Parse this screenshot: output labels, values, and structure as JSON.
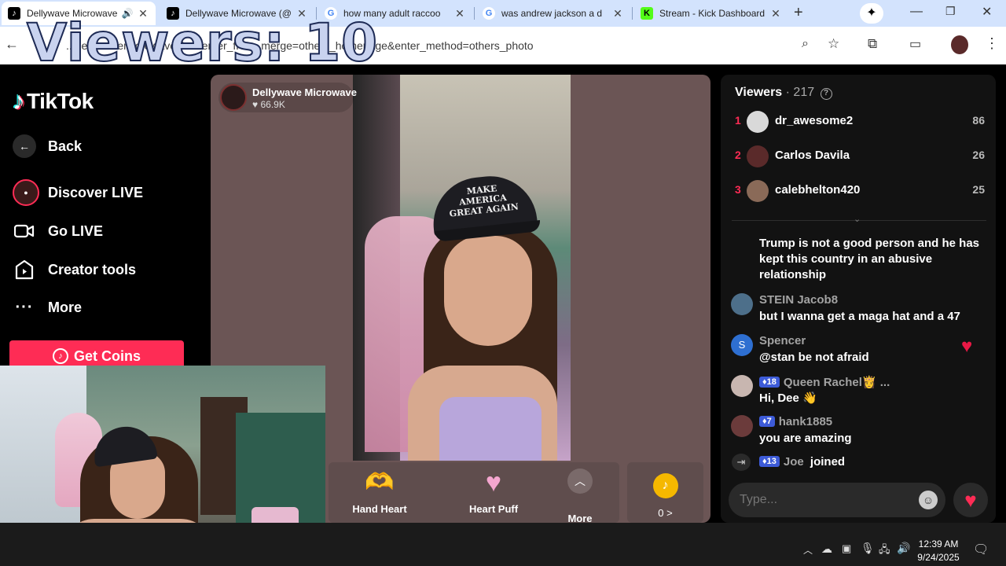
{
  "browser": {
    "tabs": [
      {
        "title": "Dellywave Microwave",
        "active": true
      },
      {
        "title": "Dellywave Microwave (@",
        "active": false
      },
      {
        "title": "how many adult raccoo",
        "active": false
      },
      {
        "title": "was andrew jackson a d",
        "active": false
      },
      {
        "title": "Stream - Kick Dashboard",
        "active": false
      }
    ],
    "url": "...dellywavemicrowave/live?enter_from_merge=others_homepage&enter_method=others_photo"
  },
  "overlay": {
    "viewers_text": "Viewers: 10"
  },
  "sidebar": {
    "logo": "TikTok",
    "back": "Back",
    "items": [
      {
        "label": "Discover LIVE",
        "icon": "discover-live-icon"
      },
      {
        "label": "Go LIVE",
        "icon": "camera-icon"
      },
      {
        "label": "Creator tools",
        "icon": "creator-tools-icon"
      },
      {
        "label": "More",
        "icon": "more-icon"
      }
    ],
    "get_coins": "Get Coins"
  },
  "stream": {
    "host_name": "Dellywave Microwave",
    "likes": "66.9K",
    "hat_text": "MAKE AMERICA GREAT AGAIN"
  },
  "gifts": {
    "items": [
      {
        "label": "Hand Heart"
      },
      {
        "label": "Heart Puff"
      }
    ],
    "more_label": "More",
    "coins_label": "0 >"
  },
  "chat": {
    "viewers_label": "Viewers",
    "viewers_count": "· 217",
    "top_viewers": [
      {
        "rank": "1",
        "name": "dr_awesome2",
        "score": "86"
      },
      {
        "rank": "2",
        "name": "Carlos Davila",
        "score": "26"
      },
      {
        "rank": "3",
        "name": "calebhelton420",
        "score": "25"
      }
    ],
    "messages": [
      {
        "user": "",
        "text": "Trump is not a good person and he has kept this country in an abusive relationship"
      },
      {
        "user": "STEIN Jacob8",
        "text": "but I wanna get a maga hat and a 47"
      },
      {
        "user": "Spencer",
        "text": "@stan be not afraid"
      },
      {
        "user": "Queen Rachel👸 ...",
        "badge": "18",
        "text": "Hi, Dee 👋"
      },
      {
        "user": "hank1885",
        "badge": "7",
        "text": "you are amazing"
      }
    ],
    "join": {
      "badge": "13",
      "user": "Joe",
      "text": "joined"
    },
    "input_placeholder": "Type..."
  },
  "taskbar": {
    "time": "12:39 AM",
    "date": "9/24/2025"
  },
  "colors": {
    "tiktok_pink": "#fe2c55",
    "chrome_tabstrip": "#d3e3fd",
    "chat_bg": "#121212",
    "stage_bg": "#6b5555"
  }
}
